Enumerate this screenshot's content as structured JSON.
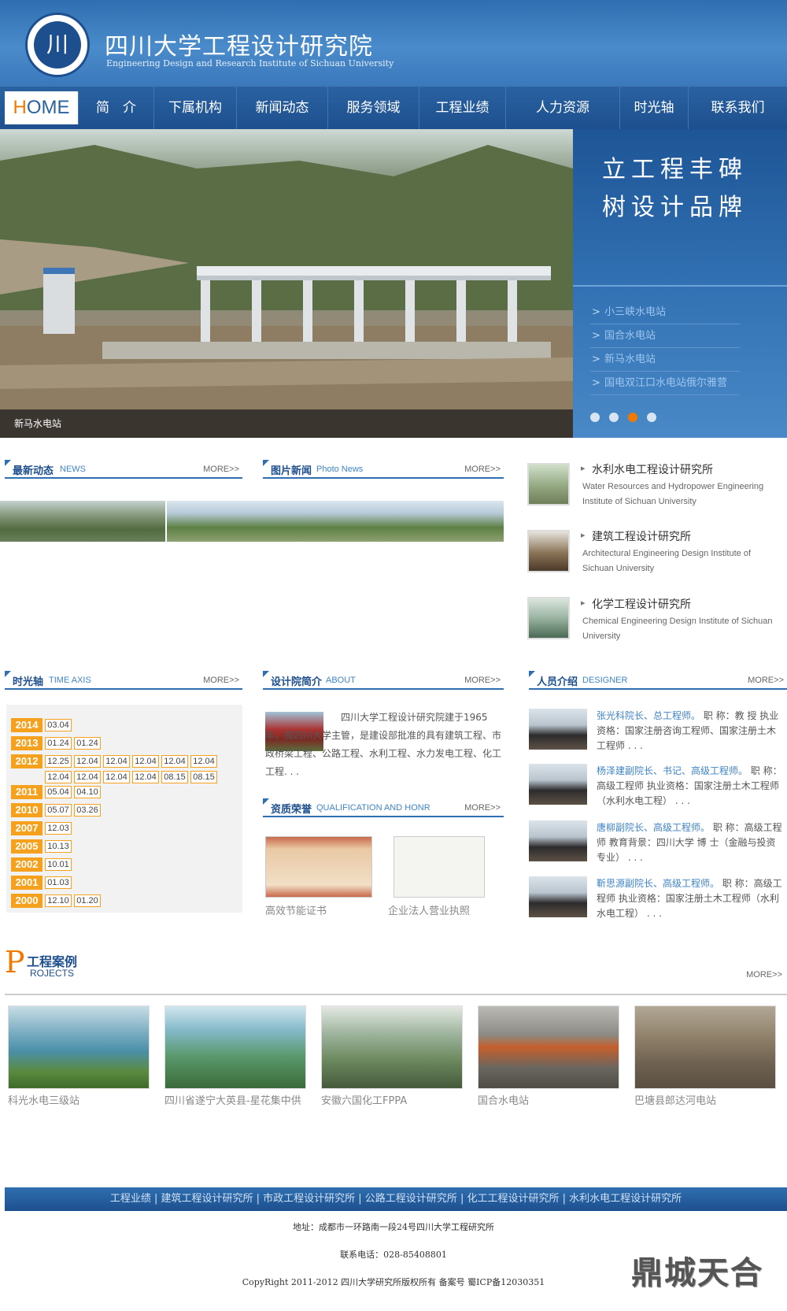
{
  "header": {
    "logo_text": "川",
    "title": "四川大学工程设计研究院",
    "subtitle": "Engineering Design and Research Institute of Sichuan University"
  },
  "nav": {
    "home_first": "H",
    "home_rest": "OME",
    "items": [
      "简　介",
      "下属机构",
      "新闻动态",
      "服务领域",
      "工程业绩",
      "人力资源",
      "时光轴",
      "联系我们"
    ]
  },
  "banner": {
    "caption": "新马水电站",
    "slogan_line1": "立工程丰碑",
    "slogan_line2": "树设计品牌",
    "links": [
      "小三峡水电站",
      "国合水电站",
      "新马水电站",
      "国电双江口水电站俄尔雅营"
    ],
    "active_dot": 2
  },
  "news": {
    "title": "最新动态",
    "en": "NEWS",
    "more": "MORE>>"
  },
  "photo_news": {
    "title": "图片新闻",
    "en": "Photo News",
    "more": "MORE>>"
  },
  "institutes": [
    {
      "title": "水利水电工程设计研究所",
      "desc": "Water Resources and Hydropower Engineering Institute of Sichuan University"
    },
    {
      "title": "建筑工程设计研究所",
      "desc": "Architectural Engineering Design Institute of Sichuan University"
    },
    {
      "title": "化学工程设计研究所",
      "desc": "Chemical Engineering Design Institute of Sichuan University"
    }
  ],
  "timeaxis": {
    "title": "时光轴",
    "en": "TIME AXIS",
    "more": "MORE>>",
    "rows": [
      {
        "year": "2014",
        "dates": [
          "03.04"
        ]
      },
      {
        "year": "2013",
        "dates": [
          "01.24",
          "01.24"
        ]
      },
      {
        "year": "2012",
        "dates": [
          "12.25",
          "12.04",
          "12.04",
          "12.04",
          "12.04",
          "12.04",
          "12.04",
          "12.04",
          "12.04",
          "12.04",
          "08.15",
          "08.15"
        ]
      },
      {
        "year": "2011",
        "dates": [
          "05.04",
          "04.10"
        ]
      },
      {
        "year": "2010",
        "dates": [
          "05.07",
          "03.26"
        ]
      },
      {
        "year": "2007",
        "dates": [
          "12.03"
        ]
      },
      {
        "year": "2005",
        "dates": [
          "10.13"
        ]
      },
      {
        "year": "2002",
        "dates": [
          "10.01"
        ]
      },
      {
        "year": "2001",
        "dates": [
          "01.03"
        ]
      },
      {
        "year": "2000",
        "dates": [
          "12.10",
          "01.20"
        ]
      }
    ]
  },
  "about": {
    "title": "设计院简介",
    "en": "ABOUT",
    "more": "MORE>>",
    "text": "四川大学工程设计研究院建于1965年，属四川大学主管，是建设部批准的具有建筑工程、市政桥梁工程、公路工程、水利工程、水力发电工程、化工工程. . ."
  },
  "honor": {
    "title": "资质荣誉",
    "en": "QUALIFICATION AND HONR",
    "more": "MORE>>",
    "items": [
      "高效节能证书",
      "企业法人营业执照"
    ]
  },
  "designer": {
    "title": "人员介绍",
    "en": "DESIGNER",
    "more": "MORE>>",
    "people": [
      {
        "name": "张光科院长、总工程师。",
        "text": "职 称：教 授 执业资格：国家注册咨询工程师、国家注册土木工程师 . . ."
      },
      {
        "name": "杨泽建副院长、书记、高级工程师。",
        "text": "职 称：高级工程师 执业资格：国家注册土木工程师（水利水电工程） . . ."
      },
      {
        "name": "唐柳副院长、高级工程师。",
        "text": "职 称：高级工程师 教育背景：四川大学 博 士（金融与投资专业） . . ."
      },
      {
        "name": "靳思源副院长、高级工程师。",
        "text": "职 称：高级工程师 执业资格：国家注册土木工程师（水利水电工程） . . ."
      }
    ]
  },
  "projects": {
    "p": "P",
    "title": "工程案例",
    "en": "ROJECTS",
    "more": "MORE>>",
    "items": [
      "科光水电三级站",
      "四川省遂宁大英县-星花集中供",
      "安徽六国化工FPPA",
      "国合水电站",
      "巴塘县郎达河电站"
    ]
  },
  "footer": {
    "nav": "工程业绩 | 建筑工程设计研究所 | 市政工程设计研究所 | 公路工程设计研究所 | 化工工程设计研究所 | 水利水电工程设计研究所",
    "address": "地址：成都市一环路南一段24号四川大学工程研究所",
    "phone": "联系电话：028-85408801",
    "copyright": "CopyRight 2011-2012 四川大学研究所版权所有 备案号 蜀ICP备12030351",
    "logo": "鼎城天合"
  }
}
